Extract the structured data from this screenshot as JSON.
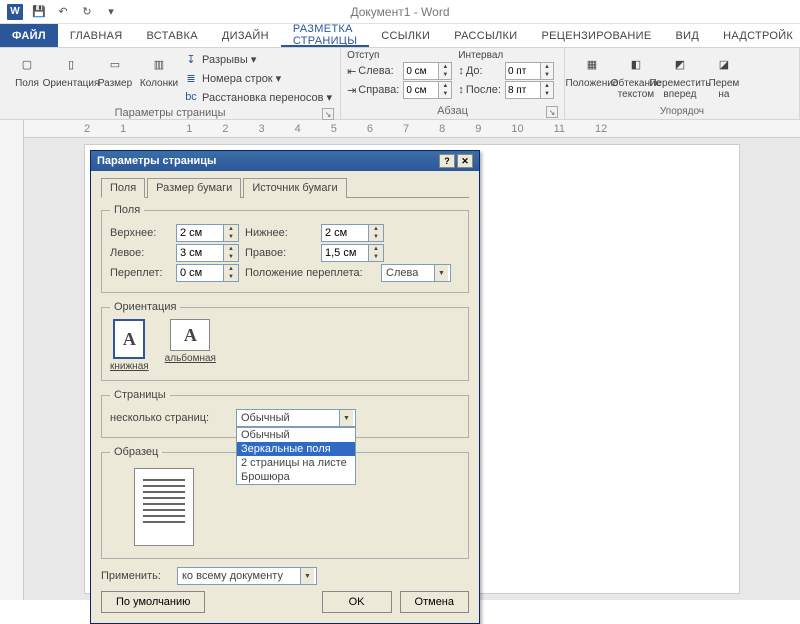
{
  "app": {
    "title": "Документ1 - Word"
  },
  "qat": {
    "save": "💾",
    "undo": "↶",
    "redo": "↻"
  },
  "tabs": {
    "file": "ФАЙЛ",
    "home": "ГЛАВНАЯ",
    "insert": "ВСТАВКА",
    "design": "ДИЗАЙН",
    "layout": "РАЗМЕТКА СТРАНИЦЫ",
    "refs": "ССЫЛКИ",
    "mail": "РАССЫЛКИ",
    "review": "РЕЦЕНЗИРОВАНИЕ",
    "view": "ВИД",
    "addins": "НАДСТРОЙК"
  },
  "ribbon": {
    "page_setup": {
      "margins": "Поля",
      "orient": "Ориентация",
      "size": "Размер",
      "columns": "Колонки",
      "breaks": "Разрывы ▾",
      "line_numbers": "Номера строк ▾",
      "hyphen": "Расстановка переносов ▾",
      "group": "Параметры страницы"
    },
    "paragraph": {
      "indent_h": "Отступ",
      "interval_h": "Интервал",
      "left_l": "Слева:",
      "right_l": "Справа:",
      "before_l": "До:",
      "after_l": "После:",
      "left_v": "0 см",
      "right_v": "0 см",
      "before_v": "0 пт",
      "after_v": "8 пт",
      "group": "Абзац"
    },
    "arrange": {
      "position": "Положение",
      "wrap": "Обтекание текстом",
      "forward": "Переместить вперед",
      "back": "Перем на",
      "group": "Упорядоч"
    }
  },
  "ruler": [
    "2",
    "1",
    "",
    "1",
    "2",
    "3",
    "4",
    "5",
    "6",
    "7",
    "8",
    "9",
    "10",
    "11",
    "12"
  ],
  "dlg": {
    "title": "Параметры страницы",
    "tabs": {
      "fields": "Поля",
      "paper": "Размер бумаги",
      "source": "Источник бумаги"
    },
    "group_fields": "Поля",
    "top_l": "Верхнее:",
    "top_v": "2 см",
    "bottom_l": "Нижнее:",
    "bottom_v": "2 см",
    "left_l": "Левое:",
    "left_v": "3 см",
    "right_l": "Правое:",
    "right_v": "1,5 см",
    "gutter_l": "Переплет:",
    "gutter_v": "0 см",
    "gutter_pos_l": "Положение переплета:",
    "gutter_pos_v": "Слева",
    "group_orient": "Ориентация",
    "portrait": "книжная",
    "landscape": "альбомная",
    "group_pages": "Страницы",
    "multi_l": "несколько страниц:",
    "multi_v": "Обычный",
    "multi_opts": [
      "Обычный",
      "Зеркальные поля",
      "2 страницы на листе",
      "Брошюра"
    ],
    "multi_sel_idx": 1,
    "group_sample": "Образец",
    "apply_l": "Применить:",
    "apply_v": "ко всему документу",
    "defaults": "По умолчанию",
    "ok": "OK",
    "cancel": "Отмена"
  }
}
